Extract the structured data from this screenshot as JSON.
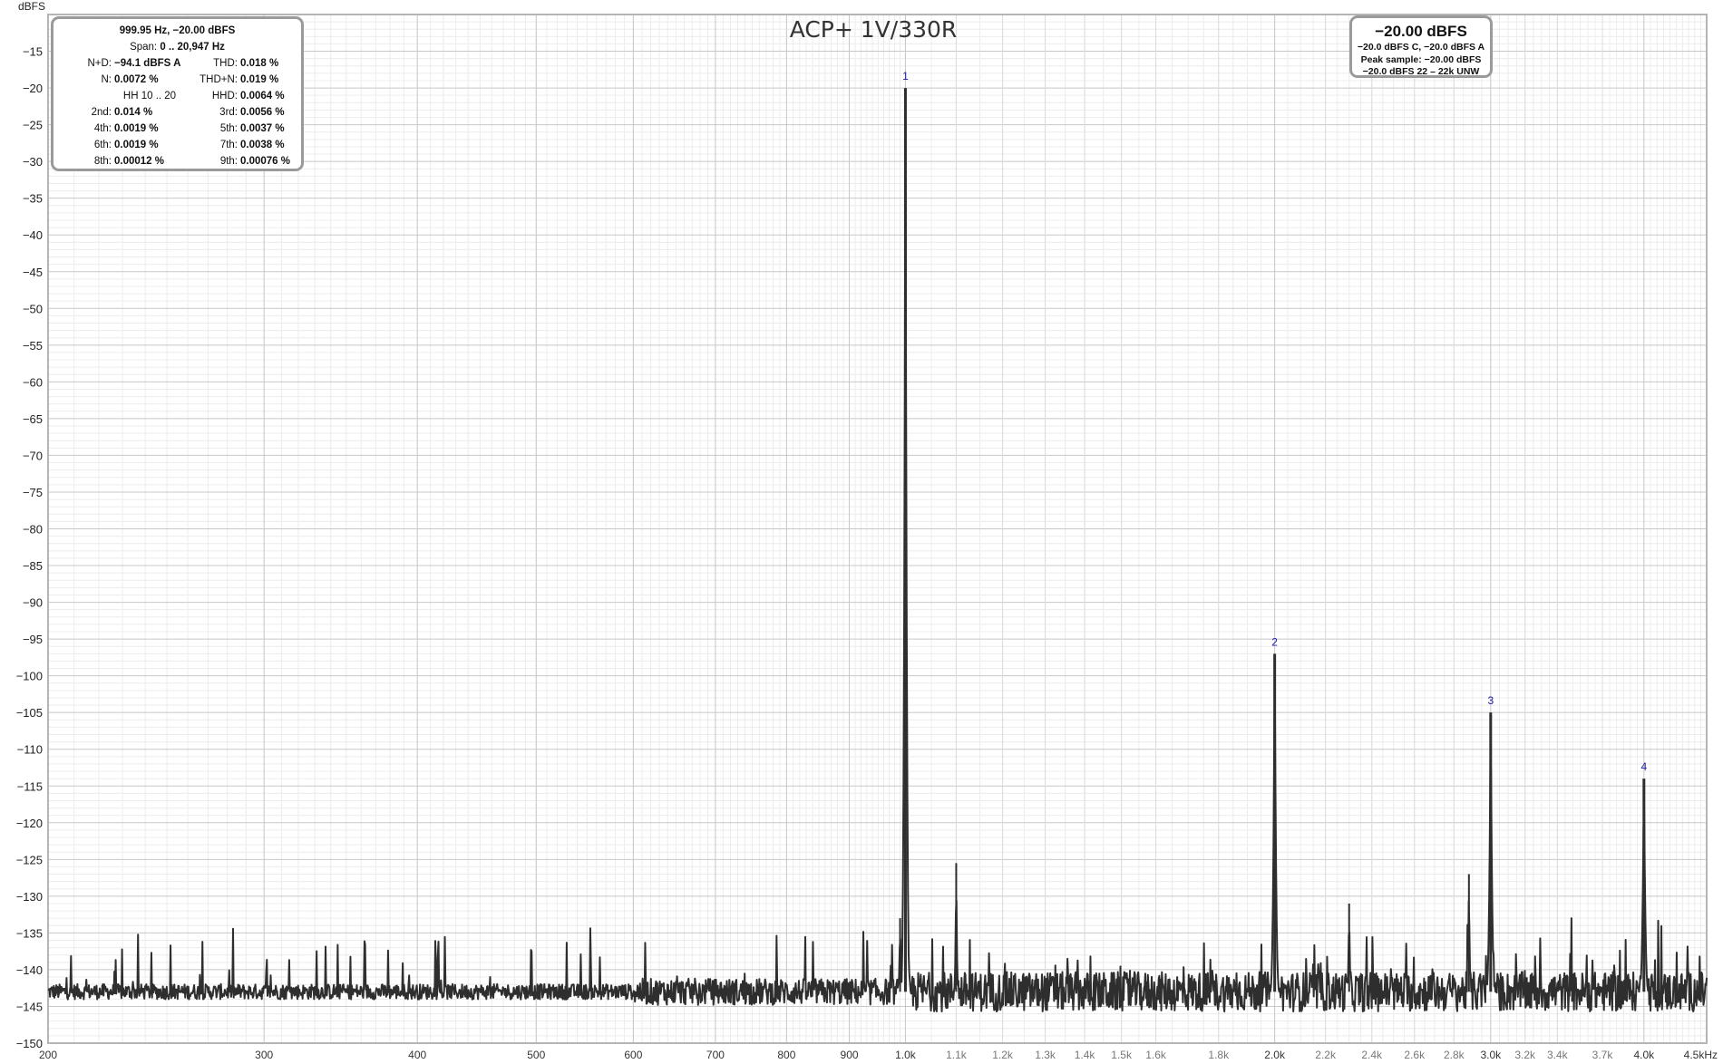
{
  "chart_data": {
    "type": "line",
    "title": "ACP+ 1V/330R",
    "ylabel": "dBFS",
    "xlabel": "",
    "x_scale": "log",
    "xlim": [
      200,
      4500
    ],
    "ylim": [
      -150,
      -10
    ],
    "grid": true,
    "y_ticks": [
      -15,
      -20,
      -25,
      -30,
      -35,
      -40,
      -45,
      -50,
      -55,
      -60,
      -65,
      -70,
      -75,
      -80,
      -85,
      -90,
      -95,
      -100,
      -105,
      -110,
      -115,
      -120,
      -125,
      -130,
      -135,
      -140,
      -145,
      -150
    ],
    "x_major_ticks": [
      {
        "value": 200,
        "label": "200"
      },
      {
        "value": 300,
        "label": "300"
      },
      {
        "value": 400,
        "label": "400"
      },
      {
        "value": 500,
        "label": "500"
      },
      {
        "value": 600,
        "label": "600"
      },
      {
        "value": 700,
        "label": "700"
      },
      {
        "value": 800,
        "label": "800"
      },
      {
        "value": 900,
        "label": "900"
      },
      {
        "value": 1000,
        "label": "1.0k"
      },
      {
        "value": 2000,
        "label": "2.0k"
      },
      {
        "value": 3000,
        "label": "3.0k"
      },
      {
        "value": 4000,
        "label": "4.0k"
      },
      {
        "value": 4500,
        "label": "4.5kHz"
      }
    ],
    "x_minor_ticks": [
      {
        "value": 1100,
        "label": "1.1k"
      },
      {
        "value": 1200,
        "label": "1.2k"
      },
      {
        "value": 1300,
        "label": "1.3k"
      },
      {
        "value": 1400,
        "label": "1.4k"
      },
      {
        "value": 1500,
        "label": "1.5k"
      },
      {
        "value": 1600,
        "label": "1.6k"
      },
      {
        "value": 1800,
        "label": "1.8k"
      },
      {
        "value": 2200,
        "label": "2.2k"
      },
      {
        "value": 2400,
        "label": "2.4k"
      },
      {
        "value": 2600,
        "label": "2.6k"
      },
      {
        "value": 2800,
        "label": "2.8k"
      },
      {
        "value": 3200,
        "label": "3.2k"
      },
      {
        "value": 3400,
        "label": "3.4k"
      },
      {
        "value": 3700,
        "label": "3.7k"
      }
    ],
    "series": [
      {
        "color": "#2e2e2e",
        "noise_floor_db": -143,
        "noise_range_db": [
          -147,
          -133
        ]
      }
    ],
    "peaks": [
      {
        "x": 1000,
        "y": -20,
        "label": "1"
      },
      {
        "x": 2000,
        "y": -97,
        "label": "2"
      },
      {
        "x": 3000,
        "y": -105,
        "label": "3"
      },
      {
        "x": 4000,
        "y": -114,
        "label": "4"
      }
    ],
    "spurs": [
      {
        "x": 990,
        "y": -133
      },
      {
        "x": 1100,
        "y": -125.5
      },
      {
        "x": 2880,
        "y": -127
      },
      {
        "x": 2300,
        "y": -131
      }
    ]
  },
  "info_left": {
    "header": "999.95 Hz, −20.00 dBFS",
    "span_label": "Span:",
    "span_value": "0 .. 20,947 Hz",
    "rows": [
      {
        "k": "N+D:",
        "v": "−94.1 dBFS A",
        "k2": "THD:",
        "v2": "0.018 %"
      },
      {
        "k": "N:",
        "v": "0.0072 %",
        "k2": "THD+N:",
        "v2": "0.019 %"
      },
      {
        "k": "",
        "v": "HH 10 .. 20",
        "k2": "HHD:",
        "v2": "0.0064 %"
      },
      {
        "k": "2nd:",
        "v": "0.014 %",
        "k2": "3rd:",
        "v2": "0.0056 %"
      },
      {
        "k": "4th:",
        "v": "0.0019 %",
        "k2": "5th:",
        "v2": "0.0037 %"
      },
      {
        "k": "6th:",
        "v": "0.0019 %",
        "k2": "7th:",
        "v2": "0.0038 %"
      },
      {
        "k": "8th:",
        "v": "0.00012 %",
        "k2": "9th:",
        "v2": "0.00076 %"
      }
    ]
  },
  "info_right": {
    "level": "−20.00 dBFS",
    "line1": "−20.0 dBFS C, −20.0 dBFS A",
    "line2": "Peak sample: −20.00 dBFS",
    "line3": "−20.0 dBFS 22 – 22k UNW"
  },
  "colors": {
    "trace": "#2e2e2e",
    "grid_major": "#c8c8c8",
    "grid_minor": "#ececec",
    "peak_label": "#1a1aa8",
    "border": "#9a9a9a"
  }
}
